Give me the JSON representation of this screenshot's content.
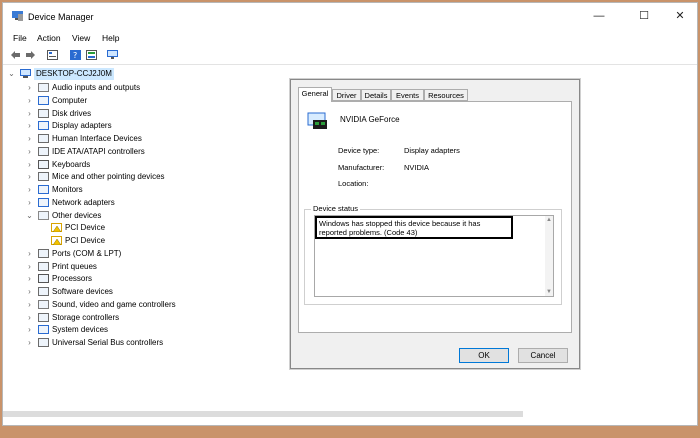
{
  "window": {
    "title": "Device Manager",
    "minimize_glyph": "—",
    "maximize_glyph": "☐",
    "close_glyph": "✕"
  },
  "menu": [
    "File",
    "Action",
    "View",
    "Help"
  ],
  "toolbar_icons": [
    "back-arrow-icon",
    "forward-arrow-icon",
    "properties-icon",
    "help-icon",
    "show-hidden-icon",
    "monitor-icon"
  ],
  "tree": {
    "root": "DESKTOP-CCJ2J0M",
    "items": [
      "Audio inputs and outputs",
      "Computer",
      "Disk drives",
      "Display adapters",
      "Human Interface Devices",
      "IDE ATA/ATAPI controllers",
      "Keyboards",
      "Mice and other pointing devices",
      "Monitors",
      "Network adapters",
      "Other devices",
      "PCI Device",
      "PCI Device",
      "Ports (COM & LPT)",
      "Print queues",
      "Processors",
      "Software devices",
      "Sound, video and game controllers",
      "Storage controllers",
      "System devices",
      "Universal Serial Bus controllers"
    ]
  },
  "dialog": {
    "tabs": [
      "General",
      "Driver",
      "Details",
      "Events",
      "Resources"
    ],
    "device_name": "NVIDIA GeForce",
    "device_type_label": "Device type:",
    "device_type_value": "Display adapters",
    "manufacturer_label": "Manufacturer:",
    "manufacturer_value": "NVIDIA",
    "location_label": "Location:",
    "location_value": "",
    "status_legend": "Device status",
    "status_text": "Windows has stopped this device because it has reported problems. (Code 43)",
    "ok_label": "OK",
    "cancel_label": "Cancel"
  },
  "colors": {
    "desktop": "#c9936a",
    "selection": "#cce8ff",
    "accent": "#0078d7"
  }
}
